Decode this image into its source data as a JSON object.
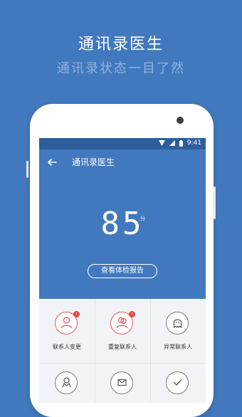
{
  "promo": {
    "headline": "通讯录医生",
    "subheadline": "通讯录状态一目了然"
  },
  "statusbar": {
    "time": "9:41"
  },
  "appbar": {
    "title": "通讯录医生",
    "back_icon": "arrow-left-icon"
  },
  "score": {
    "value": "85",
    "unit": "分"
  },
  "report_button": {
    "label": "查看体检报告"
  },
  "grid": {
    "items": [
      {
        "label": "联系人变更",
        "icon": "person-icon",
        "alert": true
      },
      {
        "label": "重复联系人",
        "icon": "duplicate-person-icon",
        "alert": true
      },
      {
        "label": "异常联系人",
        "icon": "ghost-icon",
        "alert": false
      },
      {
        "label": "",
        "icon": "person-outline-icon",
        "alert": false
      },
      {
        "label": "",
        "icon": "mail-icon",
        "alert": false
      },
      {
        "label": "",
        "icon": "check-icon",
        "alert": false
      }
    ],
    "badge_symbol": "!"
  },
  "colors": {
    "brand_blue": "#4279be",
    "status_blue": "#2f5e9d",
    "alert_red": "#e65a5a"
  }
}
